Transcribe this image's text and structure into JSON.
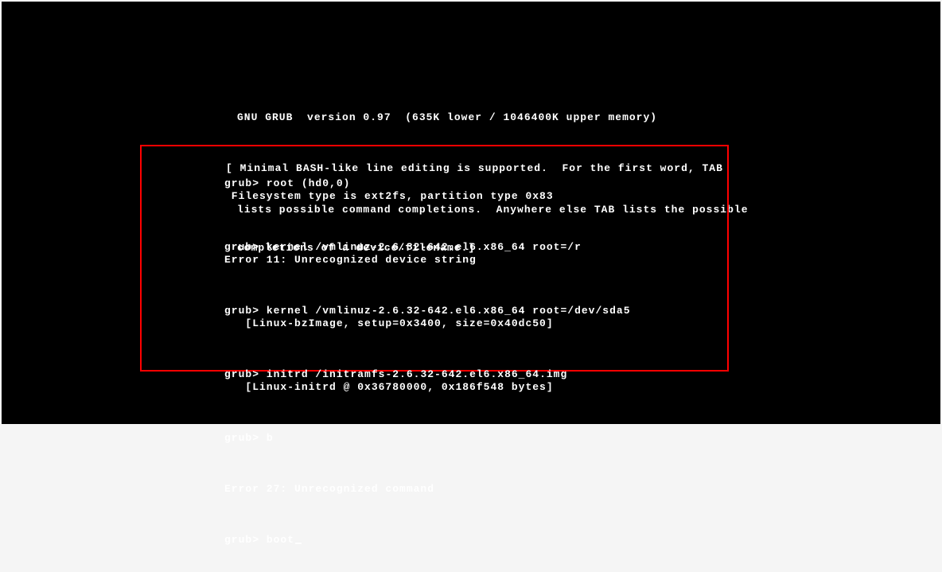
{
  "header": {
    "title": "GNU GRUB  version 0.97  (635K lower / 1046400K upper memory)",
    "help_line1": "[ Minimal BASH-like line editing is supported.  For the first word, TAB",
    "help_line2": "lists possible command completions.  Anywhere else TAB lists the possible",
    "help_line3": "completions of a device/filename.]"
  },
  "session": {
    "prompt": "grub>",
    "entries": [
      {
        "command": "root (hd0,0)",
        "output": " Filesystem type is ext2fs, partition type 0x83"
      },
      {
        "command": "kernel /vmlinuz-2.6.32-642.el6.x86_64 root=/r",
        "output": "Error 11: Unrecognized device string"
      },
      {
        "command": "kernel /vmlinuz-2.6.32-642.el6.x86_64 root=/dev/sda5",
        "output": "   [Linux-bzImage, setup=0x3400, size=0x40dc50]"
      },
      {
        "command": "initrd /initramfs-2.6.32-642.el6.x86_64.img",
        "output": "   [Linux-initrd @ 0x36780000, 0x186f548 bytes]"
      },
      {
        "command": "b",
        "output": ""
      },
      {
        "command": "",
        "output": "Error 27: Unrecognized command"
      }
    ],
    "current_input": "boot"
  }
}
